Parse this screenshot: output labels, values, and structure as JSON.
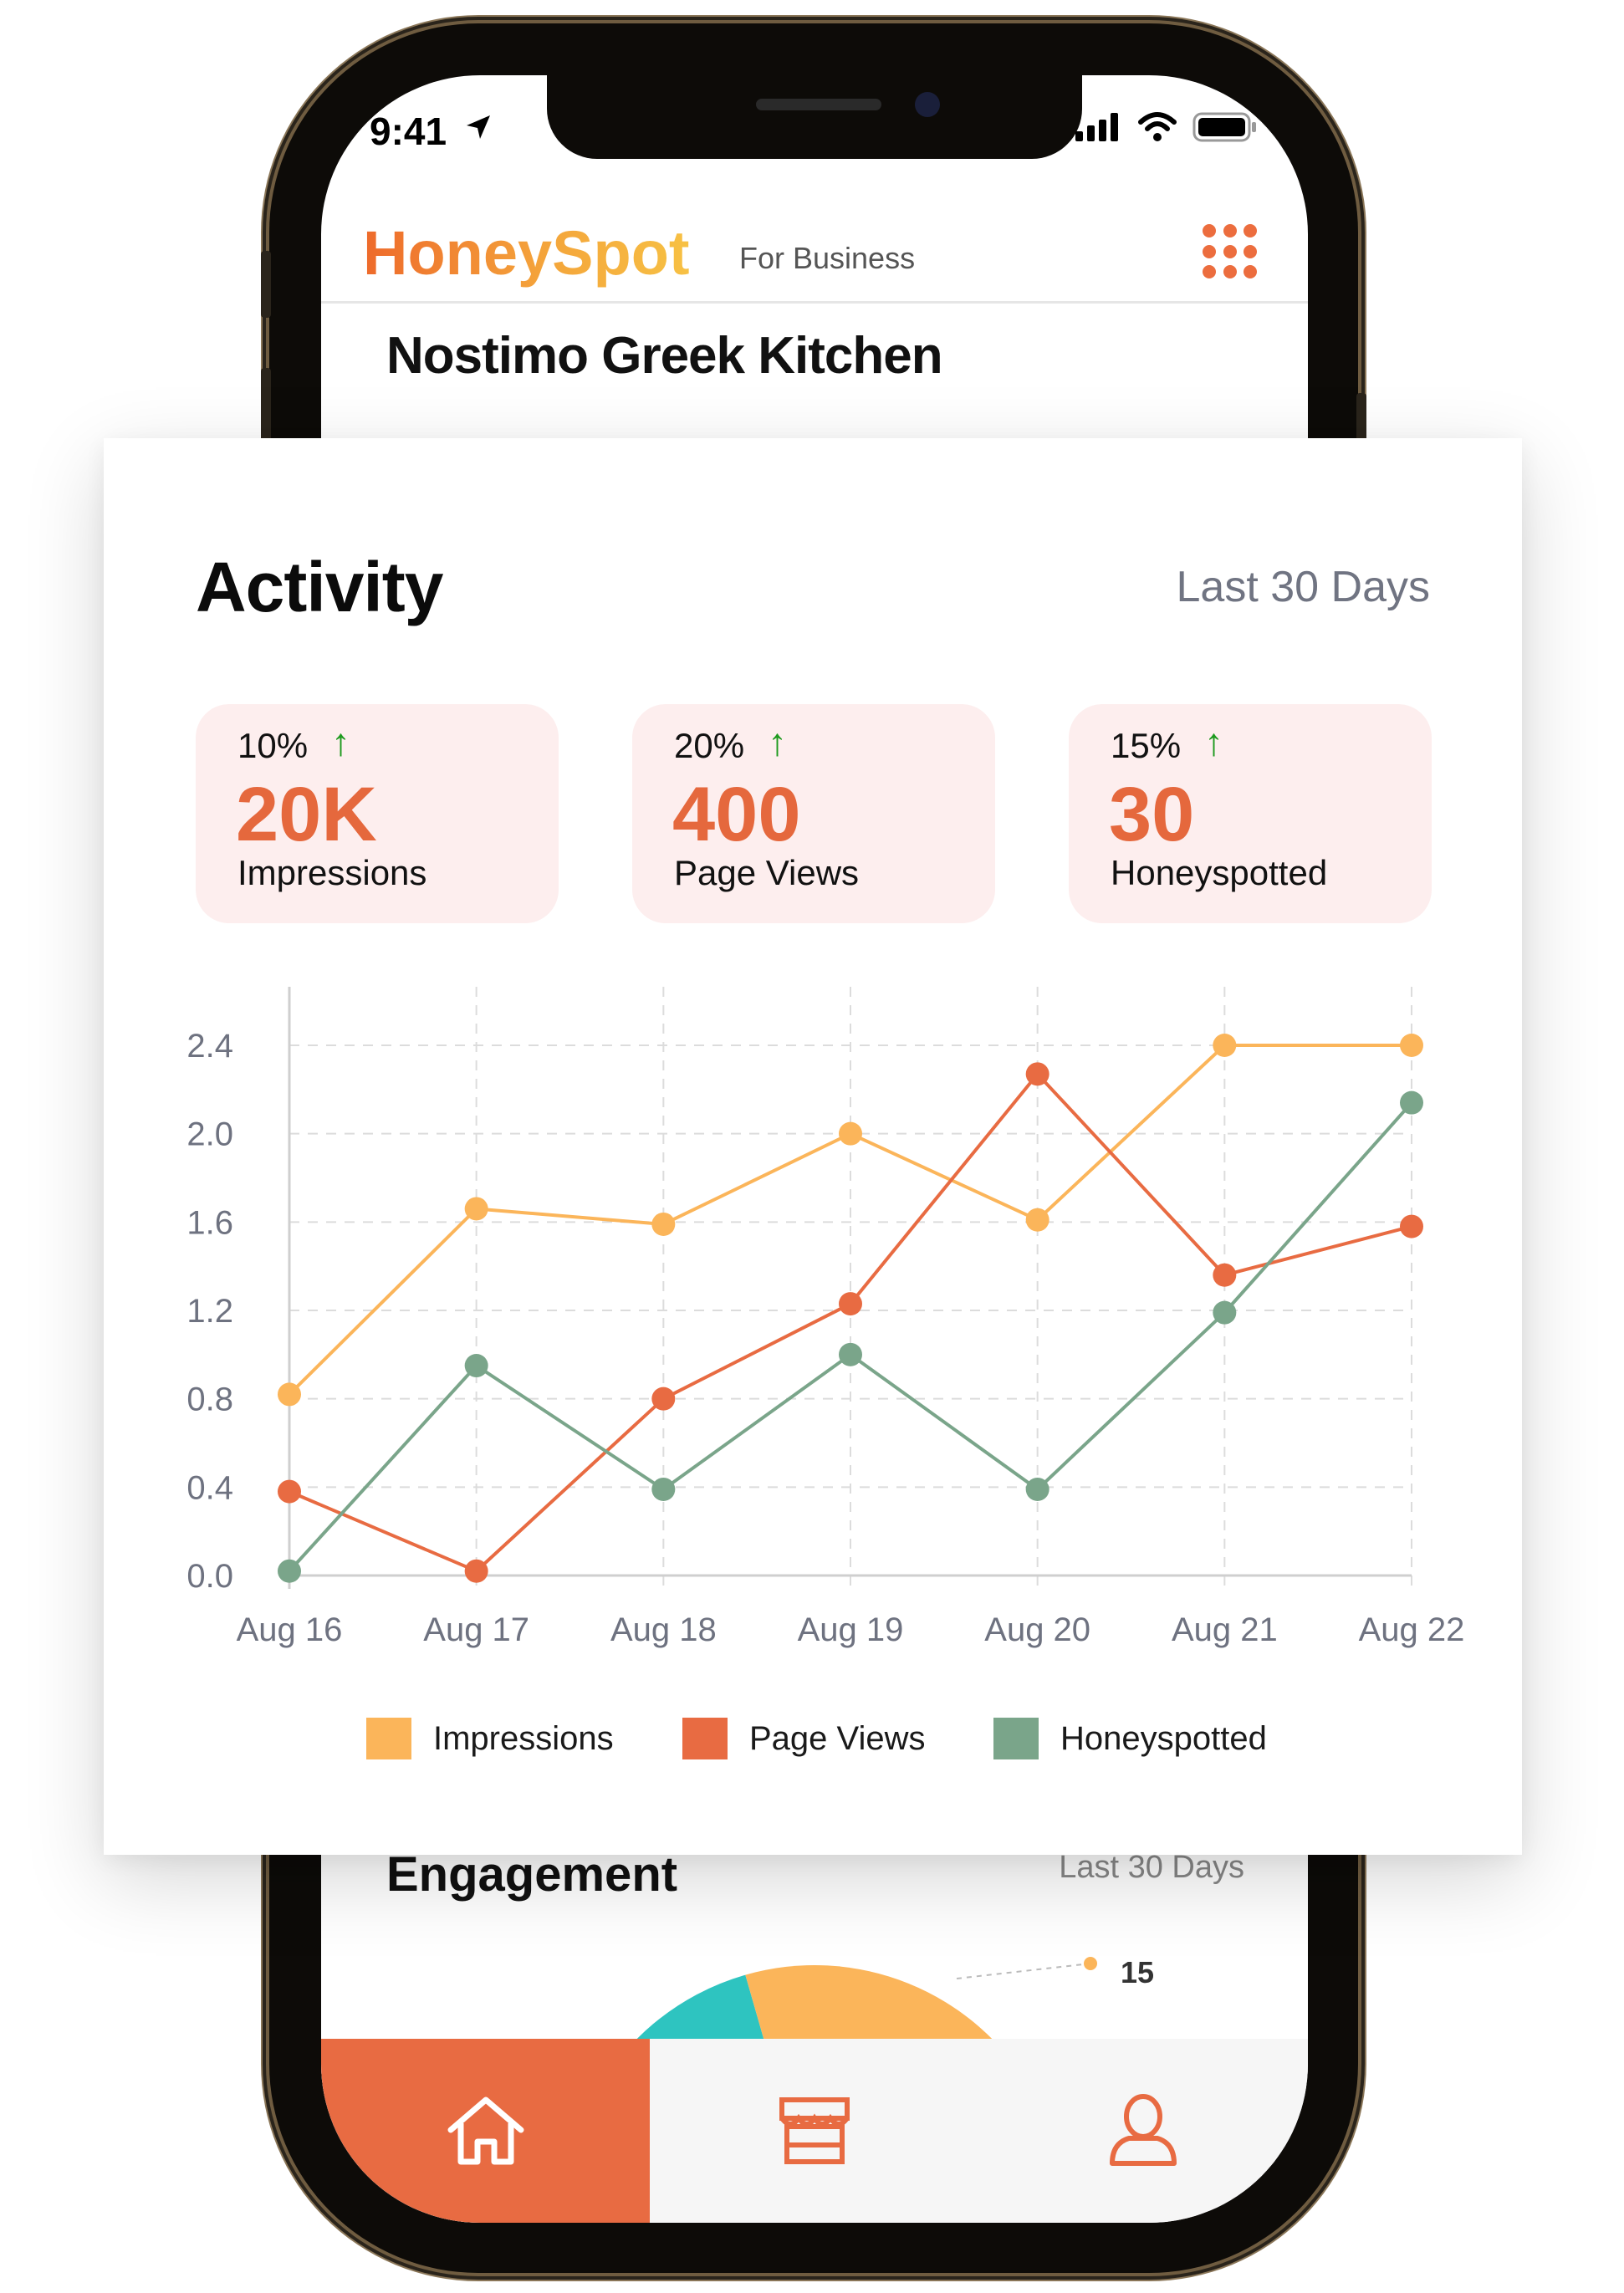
{
  "status_bar": {
    "time": "9:41"
  },
  "app": {
    "brand": "HoneySpot",
    "brand_sub": "For Business",
    "restaurant": "Nostimo Greek Kitchen"
  },
  "activity": {
    "title": "Activity",
    "range": "Last 30 Days",
    "stats": [
      {
        "pct": "10%",
        "value": "20K",
        "label": "Impressions"
      },
      {
        "pct": "20%",
        "value": "400",
        "label": "Page Views"
      },
      {
        "pct": "15%",
        "value": "30",
        "label": "Honeyspotted"
      }
    ]
  },
  "chart_data": {
    "type": "line",
    "categories": [
      "Aug 16",
      "Aug 17",
      "Aug 18",
      "Aug 19",
      "Aug 20",
      "Aug 21",
      "Aug 22"
    ],
    "yticks": [
      "0.0",
      "0.4",
      "0.8",
      "1.2",
      "1.6",
      "2.0",
      "2.4"
    ],
    "ylim": [
      0,
      2.4
    ],
    "grid": true,
    "legend_position": "bottom",
    "series": [
      {
        "name": "Impressions",
        "color": "#fbb55a",
        "values": [
          0.82,
          1.66,
          1.59,
          2.0,
          1.61,
          2.4,
          2.4
        ]
      },
      {
        "name": "Page Views",
        "color": "#e86b42",
        "values": [
          0.38,
          0.02,
          0.8,
          1.23,
          2.27,
          1.36,
          1.58
        ]
      },
      {
        "name": "Honeyspotted",
        "color": "#7aa58a",
        "values": [
          0.02,
          0.95,
          0.39,
          1.0,
          0.39,
          1.19,
          2.14
        ]
      }
    ]
  },
  "engagement": {
    "title": "Engagement",
    "range": "Last 30 Days",
    "label": "15",
    "colors": [
      "#2ec4c0",
      "#fbb55a"
    ]
  },
  "tabs": [
    {
      "icon": "home-icon",
      "active": true
    },
    {
      "icon": "store-icon",
      "active": false
    },
    {
      "icon": "profile-icon",
      "active": false
    }
  ]
}
